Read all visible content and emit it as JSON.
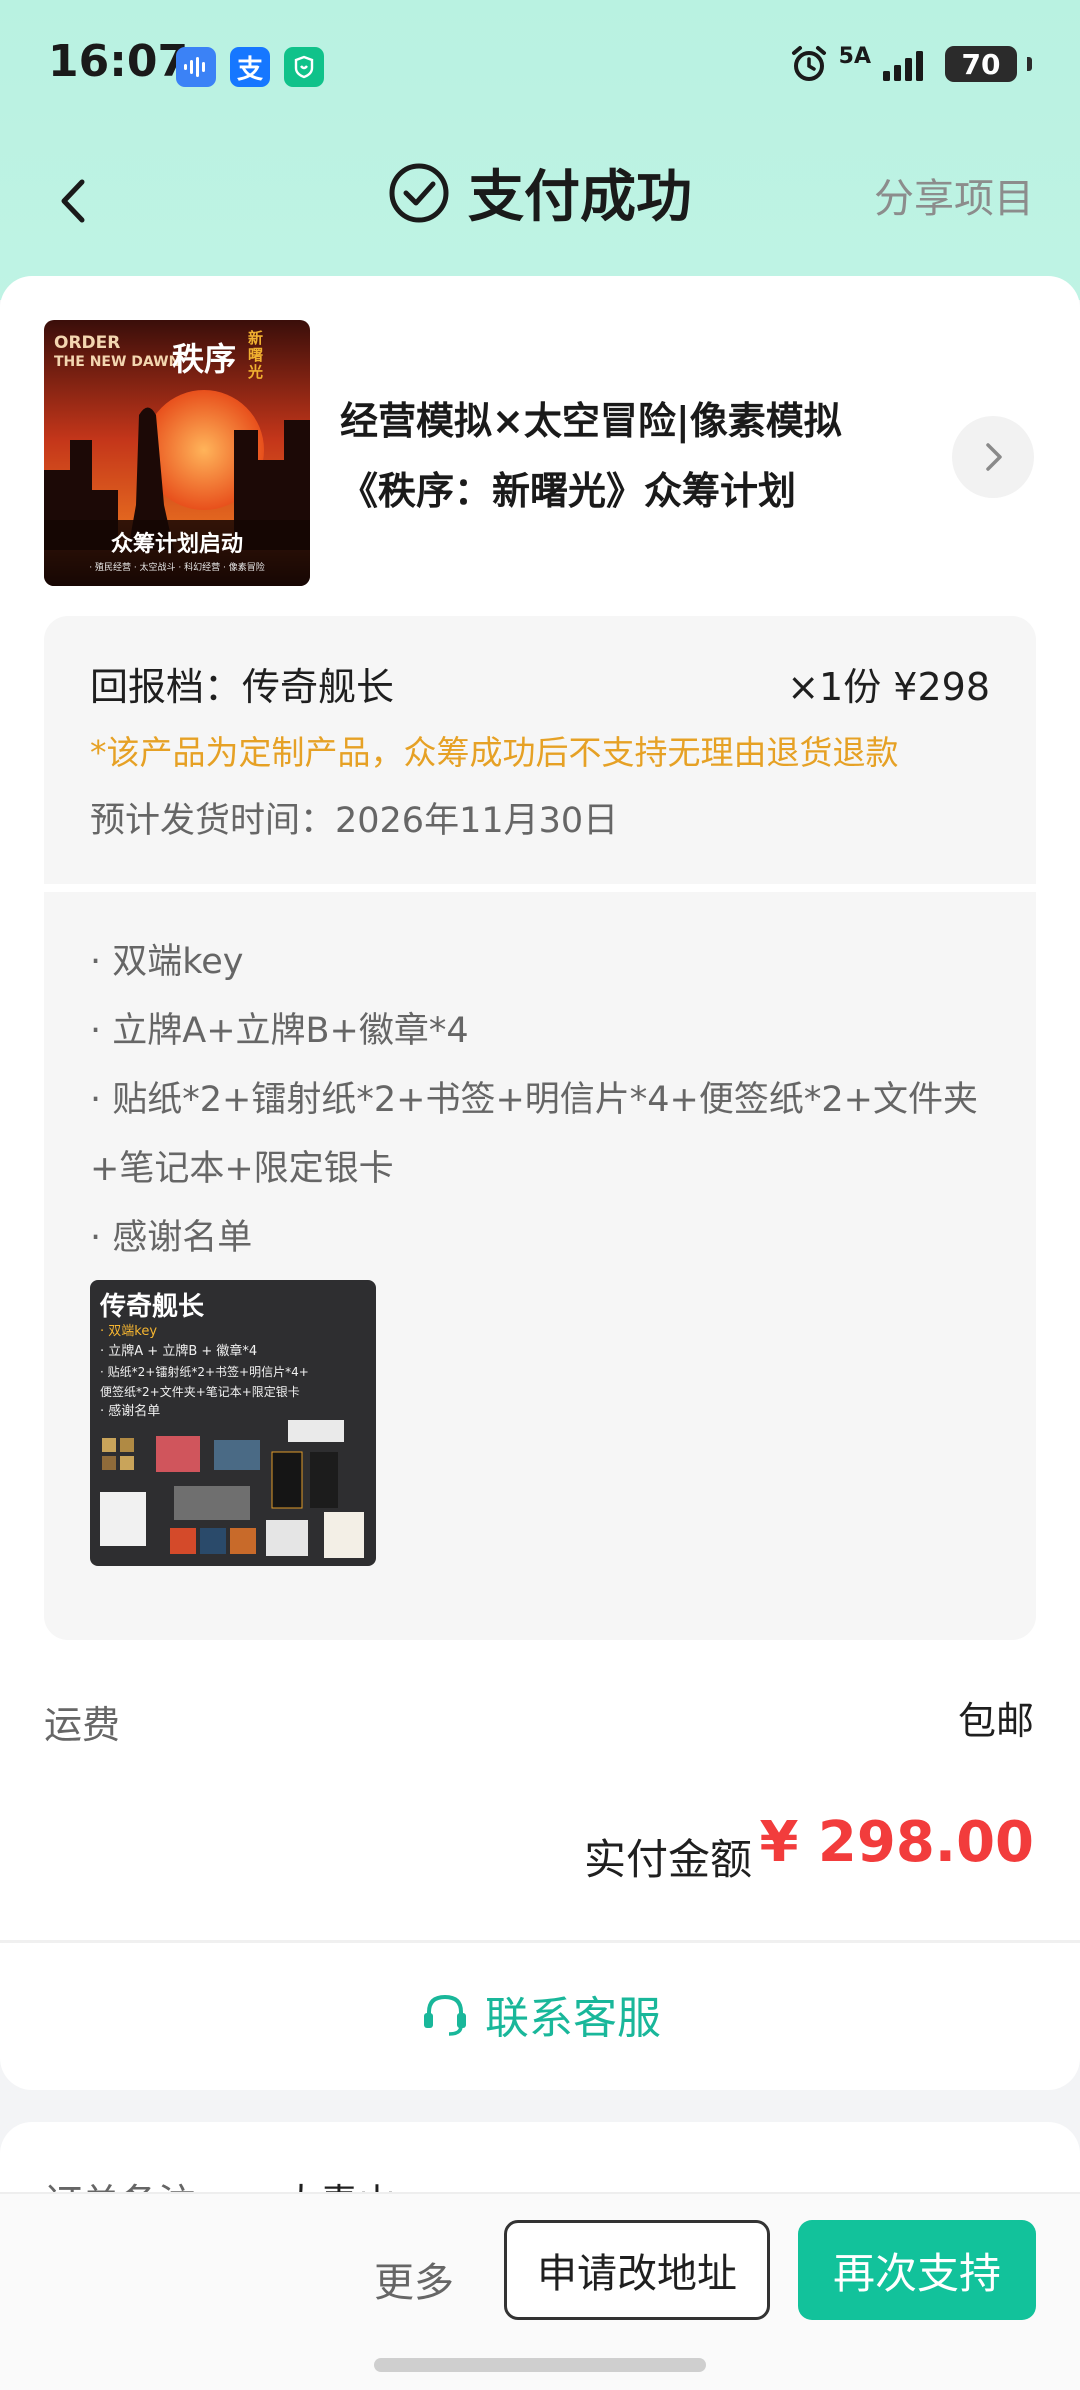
{
  "status_bar": {
    "time": "16:07",
    "network": "5A",
    "battery": "70",
    "icons": [
      "voice-app-icon",
      "alipay-icon",
      "mi-home-icon",
      "alarm-icon",
      "signal-icon",
      "battery-icon"
    ]
  },
  "header": {
    "title": "支付成功",
    "share": "分享项目"
  },
  "project": {
    "title_line1": "经营模拟×太空冒险|像素模拟",
    "title_line2": "《秩序：新曙光》众筹计划",
    "cover": {
      "logo_en_1": "ORDER",
      "logo_en_2": "THE NEW DAWN",
      "logo_cn": "秩序",
      "logo_cn_sub": "新曙光",
      "banner": "众筹计划启动",
      "tags": "· 殖民经营 · 太空战斗 · 科幻经营 · 像素冒险"
    }
  },
  "reward": {
    "tier": "回报档：传奇舰长",
    "qty_price": "×1份  ¥298",
    "notice": "*该产品为定制产品，众筹成功后不支持无理由退货退款",
    "ship_time": "预计发货时间：2026年11月30日",
    "items": [
      "· 双端key",
      "· 立牌A+立牌B+徽章*4",
      "· 贴纸*2+镭射纸*2+书签+明信片*4+便签纸*2+文件夹+笔记本+限定银卡",
      "· 感谢名单"
    ],
    "thumb": {
      "title": "传奇舰长",
      "line1": "· 双端key",
      "line2": "· 立牌A + 立牌B + 徽章*4",
      "line3": "· 贴纸*2+镭射纸*2+书签+明信片*4+",
      "line4": "便签纸*2+文件夹+笔记本+限定银卡",
      "line5": "· 感谢名单"
    }
  },
  "payment": {
    "shipping_label": "运费",
    "shipping_value": "包邮",
    "paid_label": "实付金额",
    "paid_amount": "¥ 298.00",
    "amount_color": "#f23c3c"
  },
  "service": {
    "label": "联系客服"
  },
  "order": {
    "note_label": "订单备注",
    "note_value": "大青山"
  },
  "actions": {
    "more": "更多",
    "change_address": "申请改地址",
    "support_again": "再次支持",
    "accent": "#12c29b"
  }
}
